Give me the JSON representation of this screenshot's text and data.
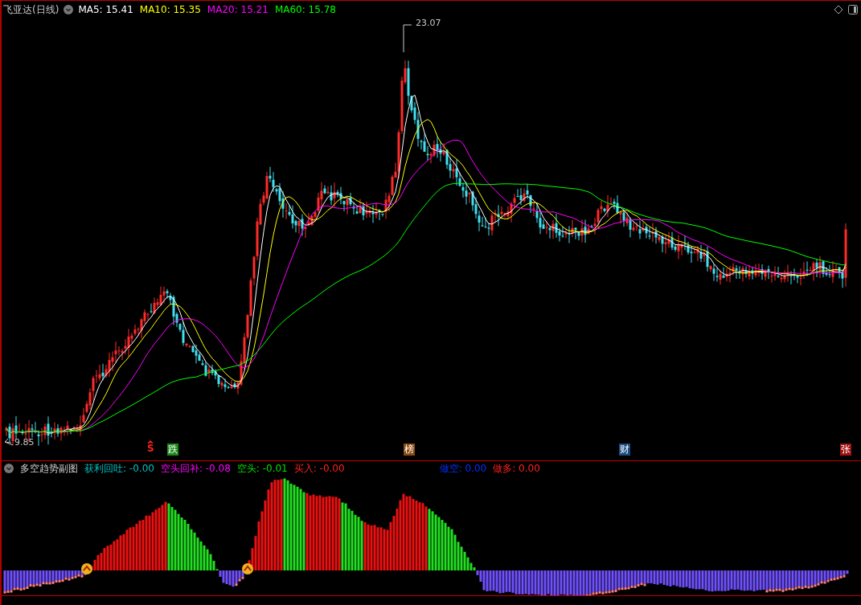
{
  "main_chart": {
    "title": "飞亚达(日线)",
    "ma_legend": [
      {
        "label": "MA5: 15.41",
        "color": "#ffffff"
      },
      {
        "label": "MA10: 15.35",
        "color": "#ffff00"
      },
      {
        "label": "MA20: 15.21",
        "color": "#ff00ff"
      },
      {
        "label": "MA60: 15.78",
        "color": "#00ff00"
      }
    ],
    "high_label": "23.07",
    "low_label": "9.85",
    "signal_marks": [
      {
        "kind": "hat",
        "text": "S",
        "color": "#ff2020"
      },
      {
        "kind": "box",
        "text": "跌",
        "color": "#1a8a1a"
      },
      {
        "kind": "box",
        "text": "榜",
        "color": "#8a4a10"
      },
      {
        "kind": "box",
        "text": "财",
        "color": "#1a4a80"
      },
      {
        "kind": "box",
        "text": "张",
        "color": "#a01010"
      }
    ]
  },
  "indicator_panel": {
    "title": "多空趋势副图",
    "legend": [
      {
        "label": "获利回吐: -0.00",
        "color": "#00c0c0"
      },
      {
        "label": "空头回补: -0.08",
        "color": "#ff00ff"
      },
      {
        "label": "空头: -0.01",
        "color": "#00e000"
      },
      {
        "label": "买入: -0.00",
        "color": "#ff2020"
      }
    ],
    "legend_right": [
      {
        "label": "做空: 0.00",
        "color": "#0030ff"
      },
      {
        "label": "做多: 0.00",
        "color": "#ff2020"
      }
    ]
  }
}
